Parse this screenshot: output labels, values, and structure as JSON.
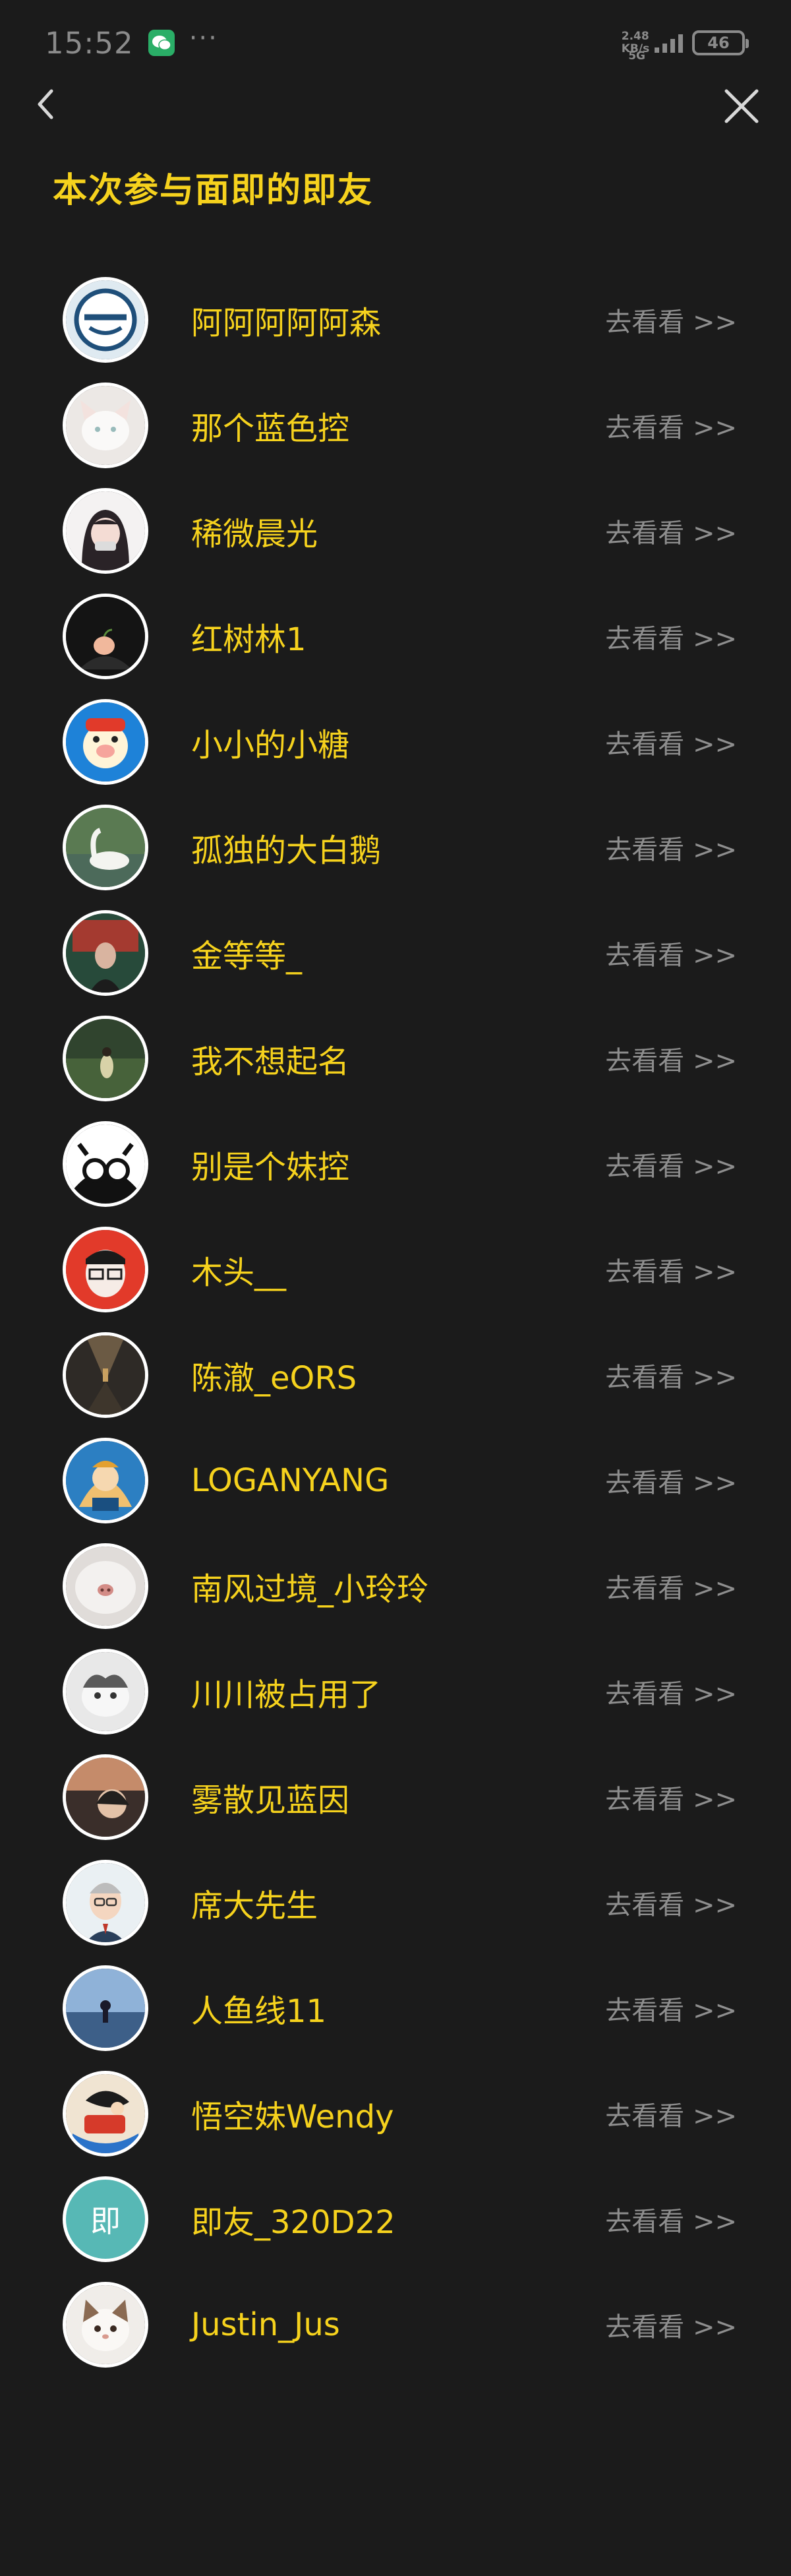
{
  "status_bar": {
    "time": "15:52",
    "dots": "···",
    "speed_value": "2.48",
    "speed_unit": "KB/s",
    "network": "5G",
    "battery": "46"
  },
  "page": {
    "title": "本次参与面即的即友"
  },
  "friends": [
    {
      "name": "阿阿阿阿阿森",
      "action": "去看看 >>",
      "avatar": "ghost-mask-avatar"
    },
    {
      "name": "那个蓝色控",
      "action": "去看看 >>",
      "avatar": "white-cat-avatar"
    },
    {
      "name": "稀微晨光",
      "action": "去看看 >>",
      "avatar": "anime-girl-avatar"
    },
    {
      "name": "红树林1",
      "action": "去看看 >>",
      "avatar": "peach-avatar"
    },
    {
      "name": "小小的小糖",
      "action": "去看看 >>",
      "avatar": "cartoon-pig-avatar"
    },
    {
      "name": "孤独的大白鹅",
      "action": "去看看 >>",
      "avatar": "swan-avatar"
    },
    {
      "name": "金等等_",
      "action": "去看看 >>",
      "avatar": "photo-portrait-avatar"
    },
    {
      "name": "我不想起名",
      "action": "去看看 >>",
      "avatar": "green-field-avatar"
    },
    {
      "name": "别是个妹控",
      "action": "去看看 >>",
      "avatar": "goggles-character-avatar"
    },
    {
      "name": "木头__",
      "action": "去看看 >>",
      "avatar": "glasses-boy-avatar"
    },
    {
      "name": "陈澈_eORS",
      "action": "去看看 >>",
      "avatar": "corridor-avatar"
    },
    {
      "name": "LOGANYANG",
      "action": "去看看 >>",
      "avatar": "comic-character-avatar"
    },
    {
      "name": "南风过境_小玲玲",
      "action": "去看看 >>",
      "avatar": "cat-nose-avatar"
    },
    {
      "name": "川川被占用了",
      "action": "去看看 >>",
      "avatar": "grey-cat-avatar"
    },
    {
      "name": "雾散见蓝因",
      "action": "去看看 >>",
      "avatar": "sunset-person-avatar"
    },
    {
      "name": "席大先生",
      "action": "去看看 >>",
      "avatar": "cartoon-man-avatar"
    },
    {
      "name": "人鱼线11",
      "action": "去看看 >>",
      "avatar": "sea-sky-avatar"
    },
    {
      "name": "悟空妹Wendy",
      "action": "去看看 >>",
      "avatar": "anime-hero-avatar"
    },
    {
      "name": "即友_320D22",
      "action": "去看看 >>",
      "avatar": "letter-avatar",
      "avatar_letter": "即"
    },
    {
      "name": "Justin_Jus",
      "action": "去看看 >>",
      "avatar": "kitten-avatar"
    }
  ],
  "colors": {
    "background": "#1b1b1b",
    "title": "#f6d21d",
    "name": "#f6d21d",
    "action": "#8e8e8e",
    "letter_avatar": "#57b8b5"
  }
}
